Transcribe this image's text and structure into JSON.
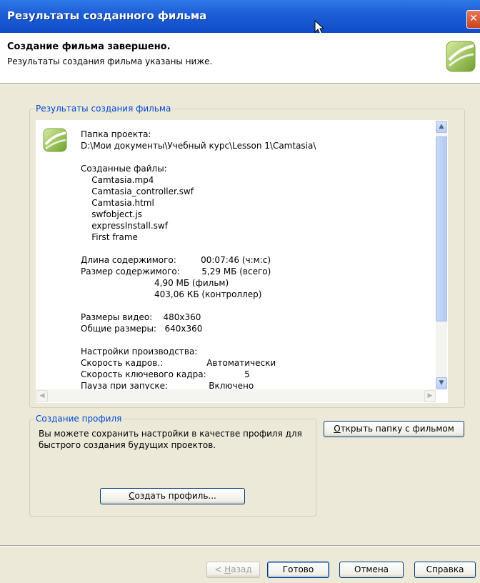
{
  "window": {
    "title": "Результаты созданного фильма",
    "close_label": "✕"
  },
  "header": {
    "title": "Создание фильма завершено.",
    "subtitle": "Результаты создания фильма указаны ниже."
  },
  "results_group": {
    "label": "Результаты создания фильма",
    "lines": [
      "Папка проекта:",
      "D:\\Мои документы\\Учебный курс\\Lesson 1\\Camtasia\\",
      "",
      "Созданные файлы:",
      "    Camtasia.mp4",
      "    Camtasia_controller.swf",
      "    Camtasia.html",
      "    swfobject.js",
      "    expressInstall.swf",
      "    First frame",
      "",
      "Длина содержимого:         00:07:46 (ч:м:с)",
      "Размер содержимого:        5,29 МБ (всего)",
      "                           4,90 МБ (фильм)",
      "                           403,06 КБ (контроллер)",
      "",
      "Размеры видео:    480x360",
      "Общие размеры:   640x360",
      "",
      "Настройки производства:",
      "Скорость кадров.:                Автоматически",
      "Скорость ключевого кадра:              5",
      "Пауза при запуске:               Включено"
    ]
  },
  "profile_group": {
    "label": "Создание профиля",
    "text": "Вы можете сохранить настройки в качестве профиля для быстрого создания будущих проектов.",
    "create_button": {
      "mnemonic": "С",
      "rest": "оздать профиль..."
    }
  },
  "open_folder_button": {
    "mnemonic": "О",
    "rest": "ткрыть папку с фильмом"
  },
  "footer": {
    "back_button": {
      "prefix": "< ",
      "mnemonic": "Н",
      "rest": "азад"
    },
    "finish_label": "Готово",
    "cancel_label": "Отмена",
    "help_label": "Справка"
  },
  "colors": {
    "titlebar": "#0f4dc7",
    "group_label": "#0046d5",
    "dialog_bg": "#ece9d8"
  },
  "icons": [
    "close-icon",
    "mouse-cursor-icon",
    "camtasia-logo-icon",
    "scroll-up-icon",
    "scroll-down-icon",
    "scroll-left-icon",
    "scroll-right-icon"
  ]
}
